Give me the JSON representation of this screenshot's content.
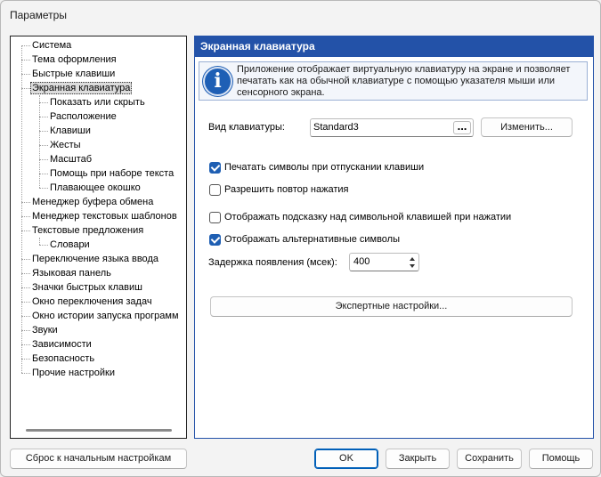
{
  "window": {
    "title": "Параметры"
  },
  "tree": {
    "items": [
      {
        "label": "Система",
        "level": 0
      },
      {
        "label": "Тема оформления",
        "level": 0
      },
      {
        "label": "Быстрые клавиши",
        "level": 0
      },
      {
        "label": "Экранная клавиатура",
        "level": 0,
        "selected": true
      },
      {
        "label": "Показать или скрыть",
        "level": 1
      },
      {
        "label": "Расположение",
        "level": 1
      },
      {
        "label": "Клавиши",
        "level": 1
      },
      {
        "label": "Жесты",
        "level": 1
      },
      {
        "label": "Масштаб",
        "level": 1
      },
      {
        "label": "Помощь при наборе текста",
        "level": 1
      },
      {
        "label": "Плавающее окошко",
        "level": 1
      },
      {
        "label": "Менеджер буфера обмена",
        "level": 0
      },
      {
        "label": "Менеджер текстовых шаблонов",
        "level": 0
      },
      {
        "label": "Текстовые предложения",
        "level": 0
      },
      {
        "label": "Словари",
        "level": 1
      },
      {
        "label": "Переключение языка ввода",
        "level": 0
      },
      {
        "label": "Языковая панель",
        "level": 0
      },
      {
        "label": "Значки быстрых клавиш",
        "level": 0
      },
      {
        "label": "Окно переключения задач",
        "level": 0
      },
      {
        "label": "Окно истории запуска программ",
        "level": 0
      },
      {
        "label": "Звуки",
        "level": 0
      },
      {
        "label": "Зависимости",
        "level": 0
      },
      {
        "label": "Безопасность",
        "level": 0
      },
      {
        "label": "Прочие настройки",
        "level": 0
      }
    ]
  },
  "panel": {
    "header": "Экранная клавиатура",
    "info_text": "Приложение отображает виртуальную клавиатуру на экране и позволяет печатать как на обычной клавиатуре с помощью указателя мыши или сенсорного экрана.",
    "keyboard_type_label": "Вид клавиатуры:",
    "keyboard_type_value": "Standard3",
    "browse_label": "...",
    "change_button": "Изменить...",
    "checkboxes": [
      {
        "label": "Печатать символы при отпускании клавиши",
        "checked": true
      },
      {
        "label": "Разрешить повтор нажатия",
        "checked": false
      },
      {
        "label": "Отображать подсказку над символьной клавишей при нажатии",
        "checked": false
      },
      {
        "label": "Отображать альтернативные символы",
        "checked": true
      }
    ],
    "delay_label": "Задержка появления (мсек):",
    "delay_value": "400",
    "expert_button": "Экспертные настройки..."
  },
  "footer": {
    "reset_button": "Сброс к начальным настройкам",
    "ok_button": "OK",
    "close_button": "Закрыть",
    "save_button": "Сохранить",
    "help_button": "Помощь"
  },
  "colors": {
    "accent": "#2352a8",
    "checkbox": "#1f5fb3"
  }
}
